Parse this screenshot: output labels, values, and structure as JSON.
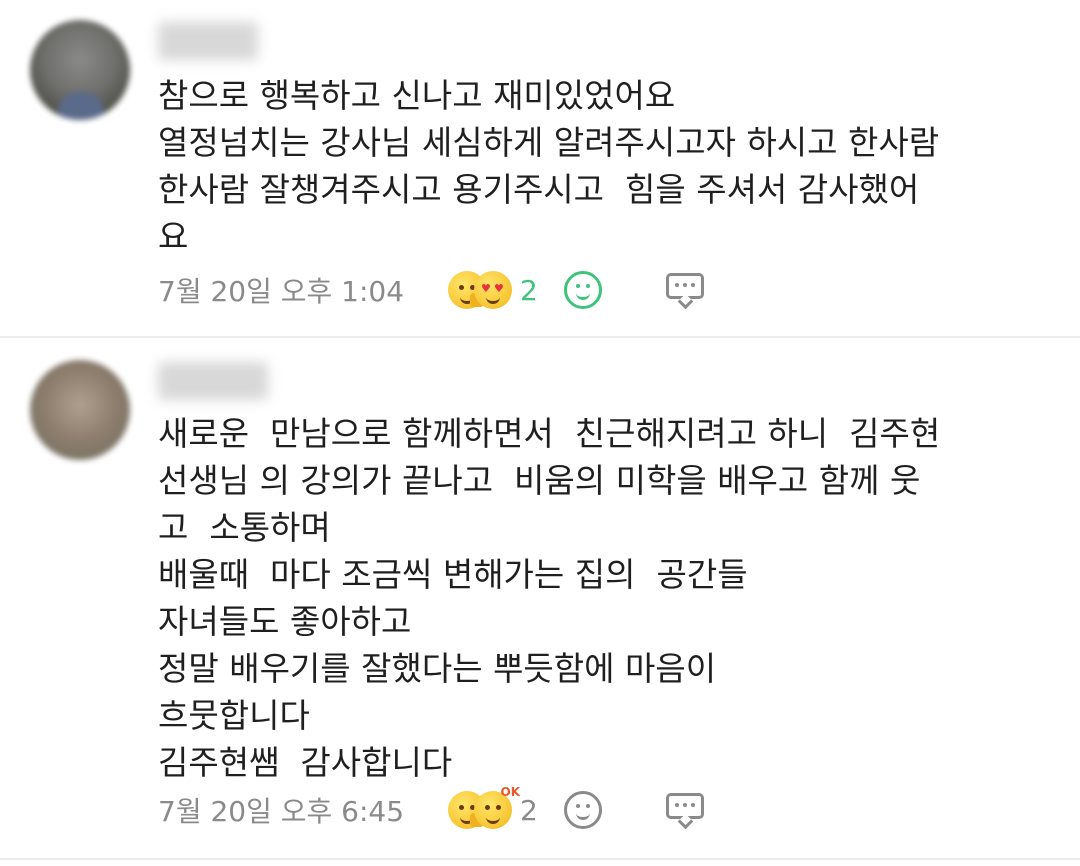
{
  "comments": [
    {
      "lines": [
        "참으로 행복하고 신나고 재미있었어요",
        "열정넘치는 강사님 세심하게 알려주시고자 하시고 한사람",
        "한사람 잘챙겨주시고 용기주시고  힘을 주셔서 감사했어",
        "요"
      ],
      "timestamp": "7월 20일 오후 1:04",
      "reaction_count": "2"
    },
    {
      "lines": [
        "새로운  만남으로 함께하면서  친근해지려고 하니  김주현",
        "선생님 의 강의가 끝나고  비움의 미학을 배우고 함께 웃",
        "고  소통하며",
        "배울때  마다 조금씩 변해가는 집의  공간들",
        "자녀들도 좋아하고",
        "정말 배우기를 잘했다는 뿌듯함에 마음이",
        "흐뭇합니다",
        "김주현쌤  감사합니다"
      ],
      "timestamp": "7월 20일 오후 6:45",
      "reaction_count": "2"
    }
  ],
  "colors": {
    "active_reaction": "#3ec37a",
    "muted": "#8a8a8a",
    "text": "#1f1f1f"
  },
  "icons": {
    "reaction_emojis_1": [
      "smiling-face-thumbs-up",
      "heart-eyes"
    ],
    "reaction_emojis_2": [
      "smiling-face-thumbs-up",
      "ok-face"
    ],
    "add_reaction": "smile-icon",
    "reply": "comment-bubble-icon"
  }
}
